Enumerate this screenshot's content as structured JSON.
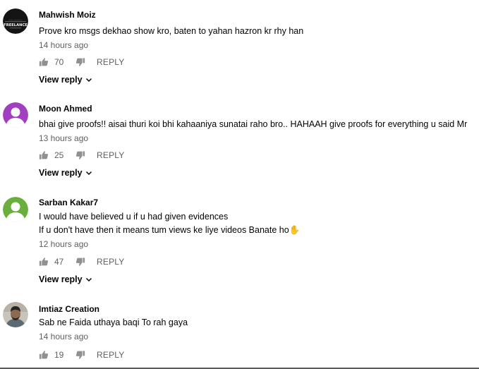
{
  "comments": [
    {
      "author": "Mahwish Moiz",
      "text_lines": [
        "Prove kro msgs dekhao show kro, baten to yahan hazron kr rhy han"
      ],
      "time": "14 hours ago",
      "likes": "70",
      "reply_label": "REPLY",
      "view_reply": "View reply",
      "avatar": {
        "kind": "logo",
        "bg": "#141414",
        "logo_text": "FREELANCE"
      }
    },
    {
      "author": "Moon Ahmed",
      "text_lines": [
        "bhai give proofs!! aisai thuri koi bhi kahaaniya sunatai raho bro.. HAHAAH give proofs for everything u said Mr"
      ],
      "time": "13 hours ago",
      "likes": "25",
      "reply_label": "REPLY",
      "view_reply": "View reply",
      "avatar": {
        "kind": "silhouette",
        "bg": "#a23fc1"
      }
    },
    {
      "author": "Sarban Kakar7",
      "text_lines": [
        "I would have believed u if u had given evidences",
        "If u don't have then it means tum views ke liye videos Banate ho✋"
      ],
      "time": "12 hours ago",
      "likes": "47",
      "reply_label": "REPLY",
      "view_reply": "View reply",
      "avatar": {
        "kind": "silhouette",
        "bg": "#6aae3d"
      }
    },
    {
      "author": "Imtiaz Creation",
      "text_lines": [
        "Sab ne Faida uthaya baqi To rah gaya"
      ],
      "time": "14 hours ago",
      "likes": "19",
      "reply_label": "REPLY",
      "avatar": {
        "kind": "photo",
        "bg": "#c9c4bb"
      }
    }
  ],
  "colors": {
    "primary_text": "#030303",
    "secondary_text": "#606060",
    "icon": "#909090"
  }
}
